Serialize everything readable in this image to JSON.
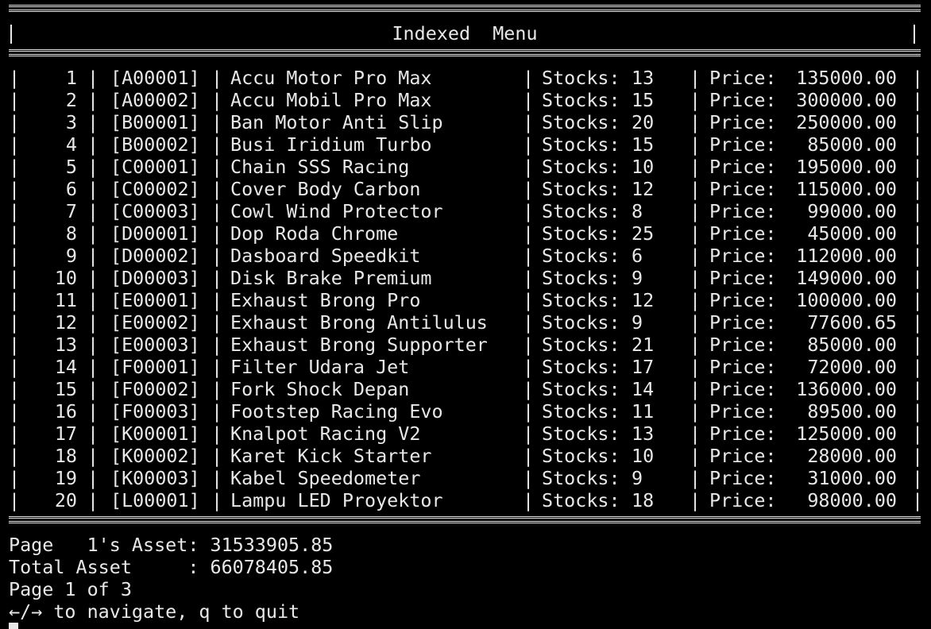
{
  "title": "Indexed  Menu",
  "rows": [
    {
      "no": "1",
      "code": "[A00001]",
      "name": "Accu Motor Pro Max",
      "stocks": "13",
      "price": "135000.00"
    },
    {
      "no": "2",
      "code": "[A00002]",
      "name": "Accu Mobil Pro Max",
      "stocks": "15",
      "price": "300000.00"
    },
    {
      "no": "3",
      "code": "[B00001]",
      "name": "Ban Motor Anti Slip",
      "stocks": "20",
      "price": "250000.00"
    },
    {
      "no": "4",
      "code": "[B00002]",
      "name": "Busi Iridium Turbo",
      "stocks": "15",
      "price": "85000.00"
    },
    {
      "no": "5",
      "code": "[C00001]",
      "name": "Chain SSS Racing",
      "stocks": "10",
      "price": "195000.00"
    },
    {
      "no": "6",
      "code": "[C00002]",
      "name": "Cover Body Carbon",
      "stocks": "12",
      "price": "115000.00"
    },
    {
      "no": "7",
      "code": "[C00003]",
      "name": "Cowl Wind Protector",
      "stocks": "8",
      "price": "99000.00"
    },
    {
      "no": "8",
      "code": "[D00001]",
      "name": "Dop Roda Chrome",
      "stocks": "25",
      "price": "45000.00"
    },
    {
      "no": "9",
      "code": "[D00002]",
      "name": "Dasboard Speedkit",
      "stocks": "6",
      "price": "112000.00"
    },
    {
      "no": "10",
      "code": "[D00003]",
      "name": "Disk Brake Premium",
      "stocks": "9",
      "price": "149000.00"
    },
    {
      "no": "11",
      "code": "[E00001]",
      "name": "Exhaust Brong Pro",
      "stocks": "12",
      "price": "100000.00"
    },
    {
      "no": "12",
      "code": "[E00002]",
      "name": "Exhaust Brong Antilulus",
      "stocks": "9",
      "price": "77600.65"
    },
    {
      "no": "13",
      "code": "[E00003]",
      "name": "Exhaust Brong Supporter",
      "stocks": "21",
      "price": "85000.00"
    },
    {
      "no": "14",
      "code": "[F00001]",
      "name": "Filter Udara Jet",
      "stocks": "17",
      "price": "72000.00"
    },
    {
      "no": "15",
      "code": "[F00002]",
      "name": "Fork Shock Depan",
      "stocks": "14",
      "price": "136000.00"
    },
    {
      "no": "16",
      "code": "[F00003]",
      "name": "Footstep Racing Evo",
      "stocks": "11",
      "price": "89500.00"
    },
    {
      "no": "17",
      "code": "[K00001]",
      "name": "Knalpot Racing V2",
      "stocks": "13",
      "price": "125000.00"
    },
    {
      "no": "18",
      "code": "[K00002]",
      "name": "Karet Kick Starter",
      "stocks": "10",
      "price": "28000.00"
    },
    {
      "no": "19",
      "code": "[K00003]",
      "name": "Kabel Speedometer",
      "stocks": "9",
      "price": "31000.00"
    },
    {
      "no": "20",
      "code": "[L00001]",
      "name": "Lampu LED Proyektor",
      "stocks": "18",
      "price": "98000.00"
    }
  ],
  "labels": {
    "stocks": "Stocks:",
    "price": "Price:",
    "separator": "|"
  },
  "footer": {
    "page_asset": "Page   1's Asset: 31533905.85",
    "total_asset": "Total Asset     : 66078405.85",
    "page_indicator": "Page 1 of 3",
    "help": "←/→ to navigate, q to quit"
  },
  "colors": {
    "background": "#000000",
    "foreground": "#e8e8e8"
  }
}
